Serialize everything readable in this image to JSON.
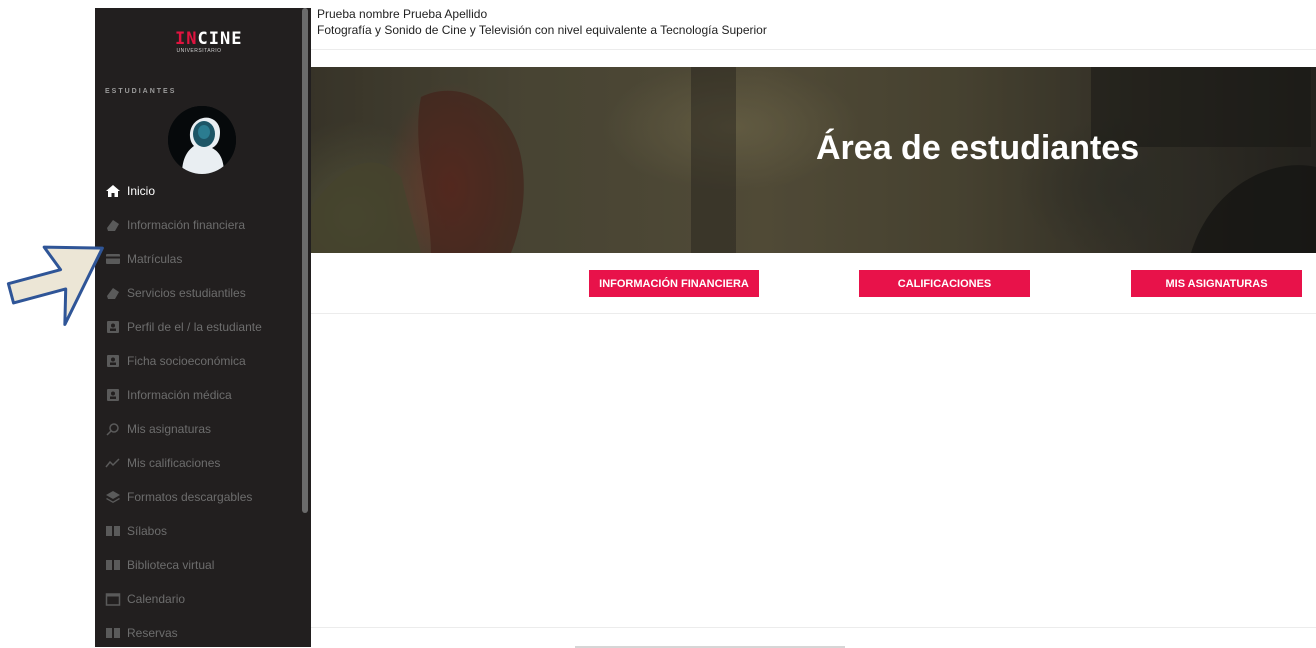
{
  "brand": {
    "logo_prefix": "IN",
    "logo_suffix": "CINE",
    "logo_sub": "UNIVERSITARIO",
    "brand_color": "#e8124a"
  },
  "sidebar": {
    "section_label": "ESTUDIANTES",
    "items": [
      {
        "label": "Inicio",
        "icon": "home-icon",
        "active": true
      },
      {
        "label": "Información financiera",
        "icon": "money-icon"
      },
      {
        "label": "Matrículas",
        "icon": "card-icon"
      },
      {
        "label": "Servicios estudiantiles",
        "icon": "money-icon"
      },
      {
        "label": "Perfil de el / la estudiante",
        "icon": "id-card-icon"
      },
      {
        "label": "Ficha socioeconómica",
        "icon": "id-card-icon"
      },
      {
        "label": "Información médica",
        "icon": "id-card-icon"
      },
      {
        "label": "Mis asignaturas",
        "icon": "search-icon"
      },
      {
        "label": "Mis calificaciones",
        "icon": "chart-line-icon"
      },
      {
        "label": "Formatos descargables",
        "icon": "layers-icon"
      },
      {
        "label": "Sílabos",
        "icon": "book-icon"
      },
      {
        "label": "Biblioteca virtual",
        "icon": "book-icon"
      },
      {
        "label": "Calendario",
        "icon": "calendar-icon"
      },
      {
        "label": "Reservas",
        "icon": "book-icon"
      }
    ]
  },
  "header": {
    "user_name": "Prueba nombre Prueba Apellido",
    "program": "Fotografía y Sonido de Cine y Televisión con nivel equivalente a Tecnología Superior"
  },
  "hero": {
    "title": "Área de estudiantes"
  },
  "actions": {
    "financial": "INFORMACIÓN FINANCIERA",
    "grades": "CALIFICACIONES",
    "subjects": "MIS ASIGNATURAS"
  },
  "colors": {
    "sidebar_bg": "#221f1f",
    "menu_text": "#6d6d6d",
    "active_text": "#ffffff",
    "button_bg": "#e8124a"
  }
}
